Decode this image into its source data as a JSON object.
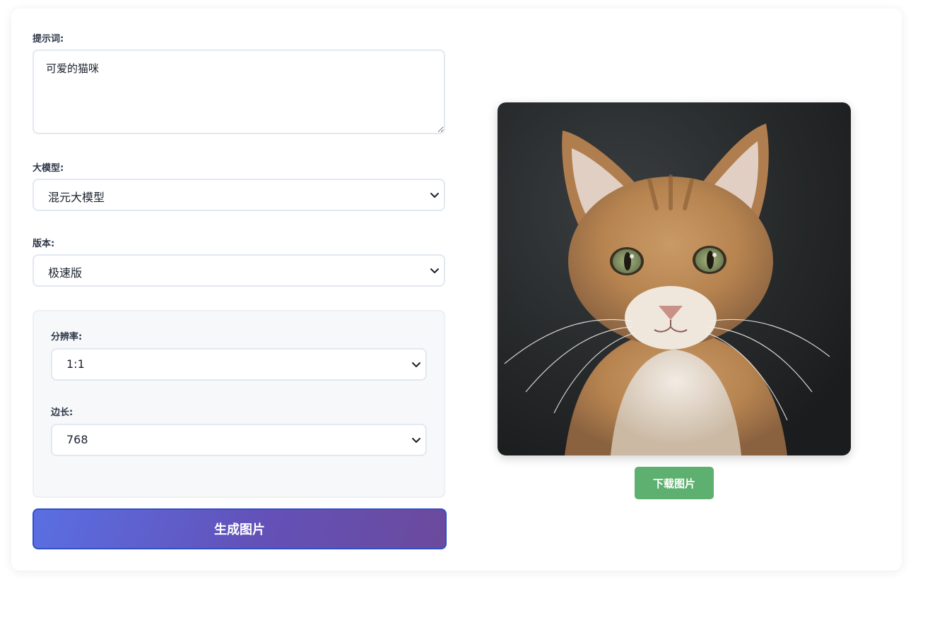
{
  "prompt": {
    "label": "提示词:",
    "value": "可爱的猫咪"
  },
  "model": {
    "label": "大模型:",
    "selected": "混元大模型"
  },
  "version": {
    "label": "版本:",
    "selected": "极速版"
  },
  "advanced": {
    "resolution": {
      "label": "分辨率:",
      "selected": "1:1"
    },
    "side_length": {
      "label": "边长:",
      "selected": "768"
    }
  },
  "generate_button": {
    "label": "生成图片"
  },
  "download_button": {
    "label": "下载图片"
  },
  "image": {
    "subject": "cat-photo"
  },
  "colors": {
    "accent_gradient_start": "#5a6fe2",
    "accent_gradient_end": "#6b4a9c",
    "download": "#5db06f"
  }
}
